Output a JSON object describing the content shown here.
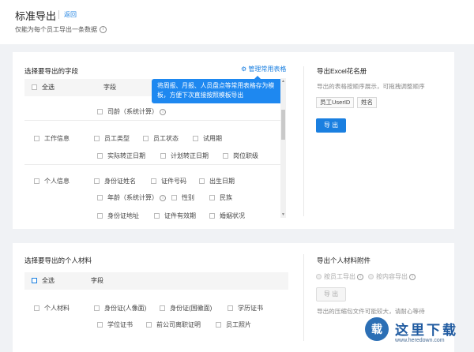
{
  "header": {
    "title": "标准导出",
    "back": "返回",
    "subtitle": "仅能为每个员工导出一条数据",
    "info_glyph": "i"
  },
  "fields": {
    "section_title": "选择要导出的字段",
    "manage_link": "管理常用表格",
    "tooltip": "将周报、月报、人员盘点等常用表格存为模板，方便下次直接按照模板导出",
    "col_select_all": "全选",
    "col_field": "字段",
    "age_opt": "司龄（系统计算）",
    "work_label": "工作信息",
    "work_row1": [
      "员工类型",
      "员工状态",
      "试用期"
    ],
    "work_row2": [
      "实际转正日期",
      "计划转正日期",
      "岗位职级"
    ],
    "personal_label": "个人信息",
    "personal_row1": [
      "身份证姓名",
      "证件号码",
      "出生日期"
    ],
    "personal_row2": [
      "年龄（系统计算）",
      "性别",
      "民族"
    ],
    "personal_row3": [
      "身份证地址",
      "证件有效期",
      "婚姻状况"
    ]
  },
  "roster": {
    "title": "导出Excel花名册",
    "desc": "导出的表格按顺序展示，可拖拽调整顺序",
    "tags": [
      "员工UserID",
      "姓名"
    ],
    "export_btn": "导 出"
  },
  "materials": {
    "section_title": "选择要导出的个人材料",
    "col_select_all": "全选",
    "col_field": "字段",
    "label": "个人材料",
    "row1": [
      "身份证(人像面)",
      "身份证(国徽面)",
      "学历证书"
    ],
    "row2": [
      "学位证书",
      "前公司离职证明",
      "员工照片"
    ]
  },
  "attachments": {
    "title": "导出个人材料附件",
    "radio1": "按员工导出",
    "radio2": "按内容导出",
    "export_btn": "导 出",
    "desc": "导出的压缩包文件可能较大，请耐心等待"
  },
  "watermark": {
    "text": "这里下载",
    "url": "www.heredown.com",
    "badge": "载"
  },
  "colors": {
    "accent": "#1a7fe0",
    "tooltip_bg": "#1e88f0",
    "page_bg": "#f0f2f5"
  }
}
